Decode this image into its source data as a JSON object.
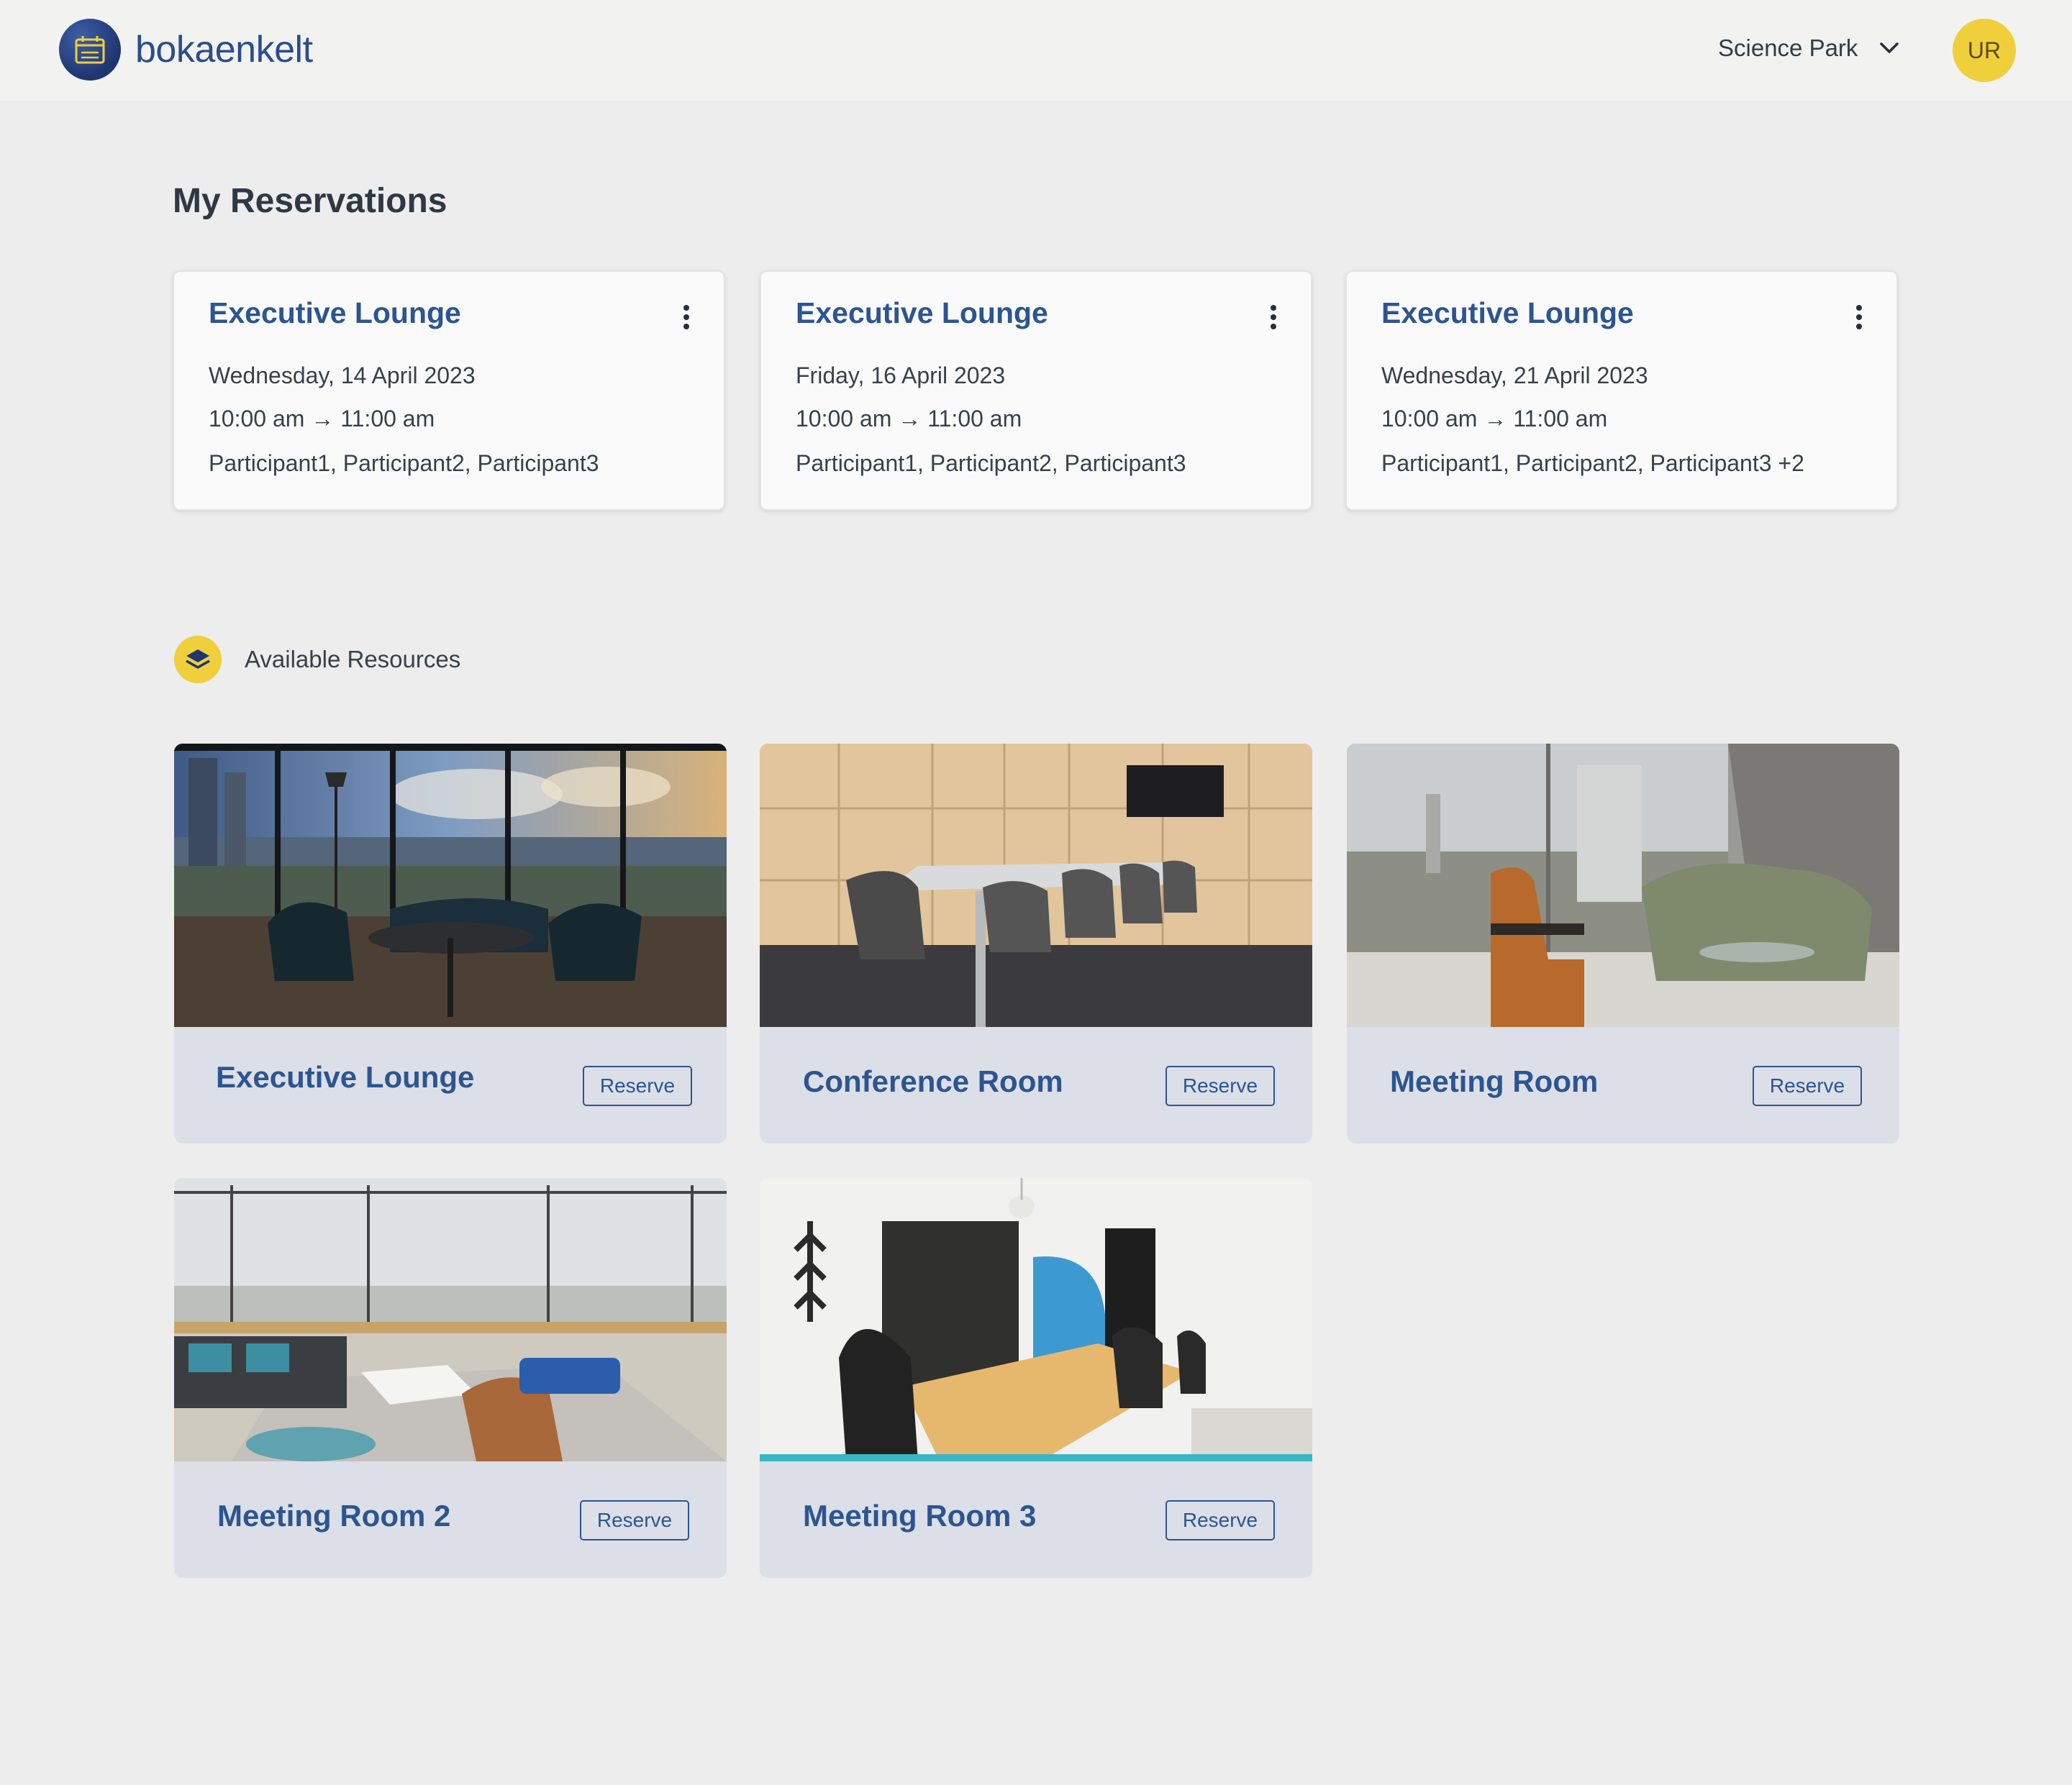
{
  "header": {
    "brand": "bokaenkelt",
    "location": "Science Park",
    "avatar_initials": "UR"
  },
  "reservations": {
    "title": "My Reservations",
    "items": [
      {
        "room": "Executive Lounge",
        "date": "Wednesday, 14 April 2023",
        "time": "10:00 am → 11:00 am",
        "participants": "Participant1, Participant2, Participant3"
      },
      {
        "room": "Executive Lounge",
        "date": "Friday, 16 April 2023",
        "time": "10:00 am → 11:00 am",
        "participants": "Participant1, Participant2, Participant3"
      },
      {
        "room": "Executive Lounge",
        "date": "Wednesday, 21 April 2023",
        "time": "10:00 am → 11:00 am",
        "participants": "Participant1, Participant2, Participant3 +2"
      }
    ]
  },
  "resources": {
    "title": "Available Resources",
    "reserve_label": "Reserve",
    "items": [
      {
        "name": "Executive Lounge"
      },
      {
        "name": "Conference Room"
      },
      {
        "name": "Meeting Room"
      },
      {
        "name": "Meeting Room 2"
      },
      {
        "name": "Meeting Room 3"
      }
    ]
  },
  "colors": {
    "brand_blue": "#2c5591",
    "accent_yellow": "#f0cf3c",
    "page_bg": "#ededed"
  }
}
